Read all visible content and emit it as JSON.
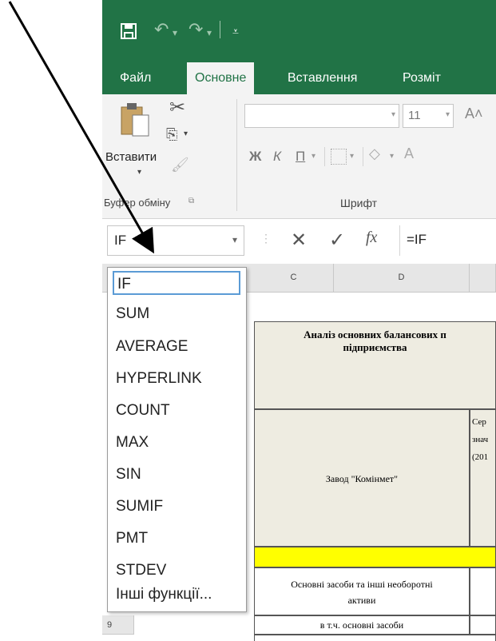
{
  "tabs": {
    "file": "Файл",
    "home": "Основне",
    "insert": "Вставлення",
    "layout": "Розміт"
  },
  "clipboard": {
    "paste_label": "Вставити",
    "group_label": "Буфер обміну"
  },
  "font": {
    "size_value": "11",
    "bold": "Ж",
    "italic": "К",
    "underline": "П",
    "group_label": "Шрифт"
  },
  "name_box": {
    "value": "IF"
  },
  "formula_bar": {
    "fx_label": "fx",
    "formula_value": "=IF"
  },
  "function_list": {
    "items": [
      "IF",
      "SUM",
      "AVERAGE",
      "HYPERLINK",
      "COUNT",
      "MAX",
      "SIN",
      "SUMIF",
      "PMT",
      "STDEV",
      "Інші функції..."
    ],
    "selected_index": 0
  },
  "sheet": {
    "column_headers": [
      "C",
      "D"
    ],
    "row_9_label": "9",
    "table_title": "Аналіз основних балансових п… підприємства",
    "title_line1": "Аналіз основних балансових п",
    "title_line2": "підприємства",
    "company_cell": "Завод \"Комінмет\"",
    "avg_label_1": "Сер",
    "avg_label_2": "знач",
    "avg_label_3": "(201",
    "fixed_assets_line1": "Основні засоби та інші необоротні",
    "fixed_assets_line2": "активи",
    "incl_fixed_assets": "в т.ч. основні засоби"
  },
  "colors": {
    "excel_green": "#217346",
    "yellow_row": "#ffff00",
    "beige_cell": "#eeece1",
    "selection_blue": "#5b9bd5"
  }
}
